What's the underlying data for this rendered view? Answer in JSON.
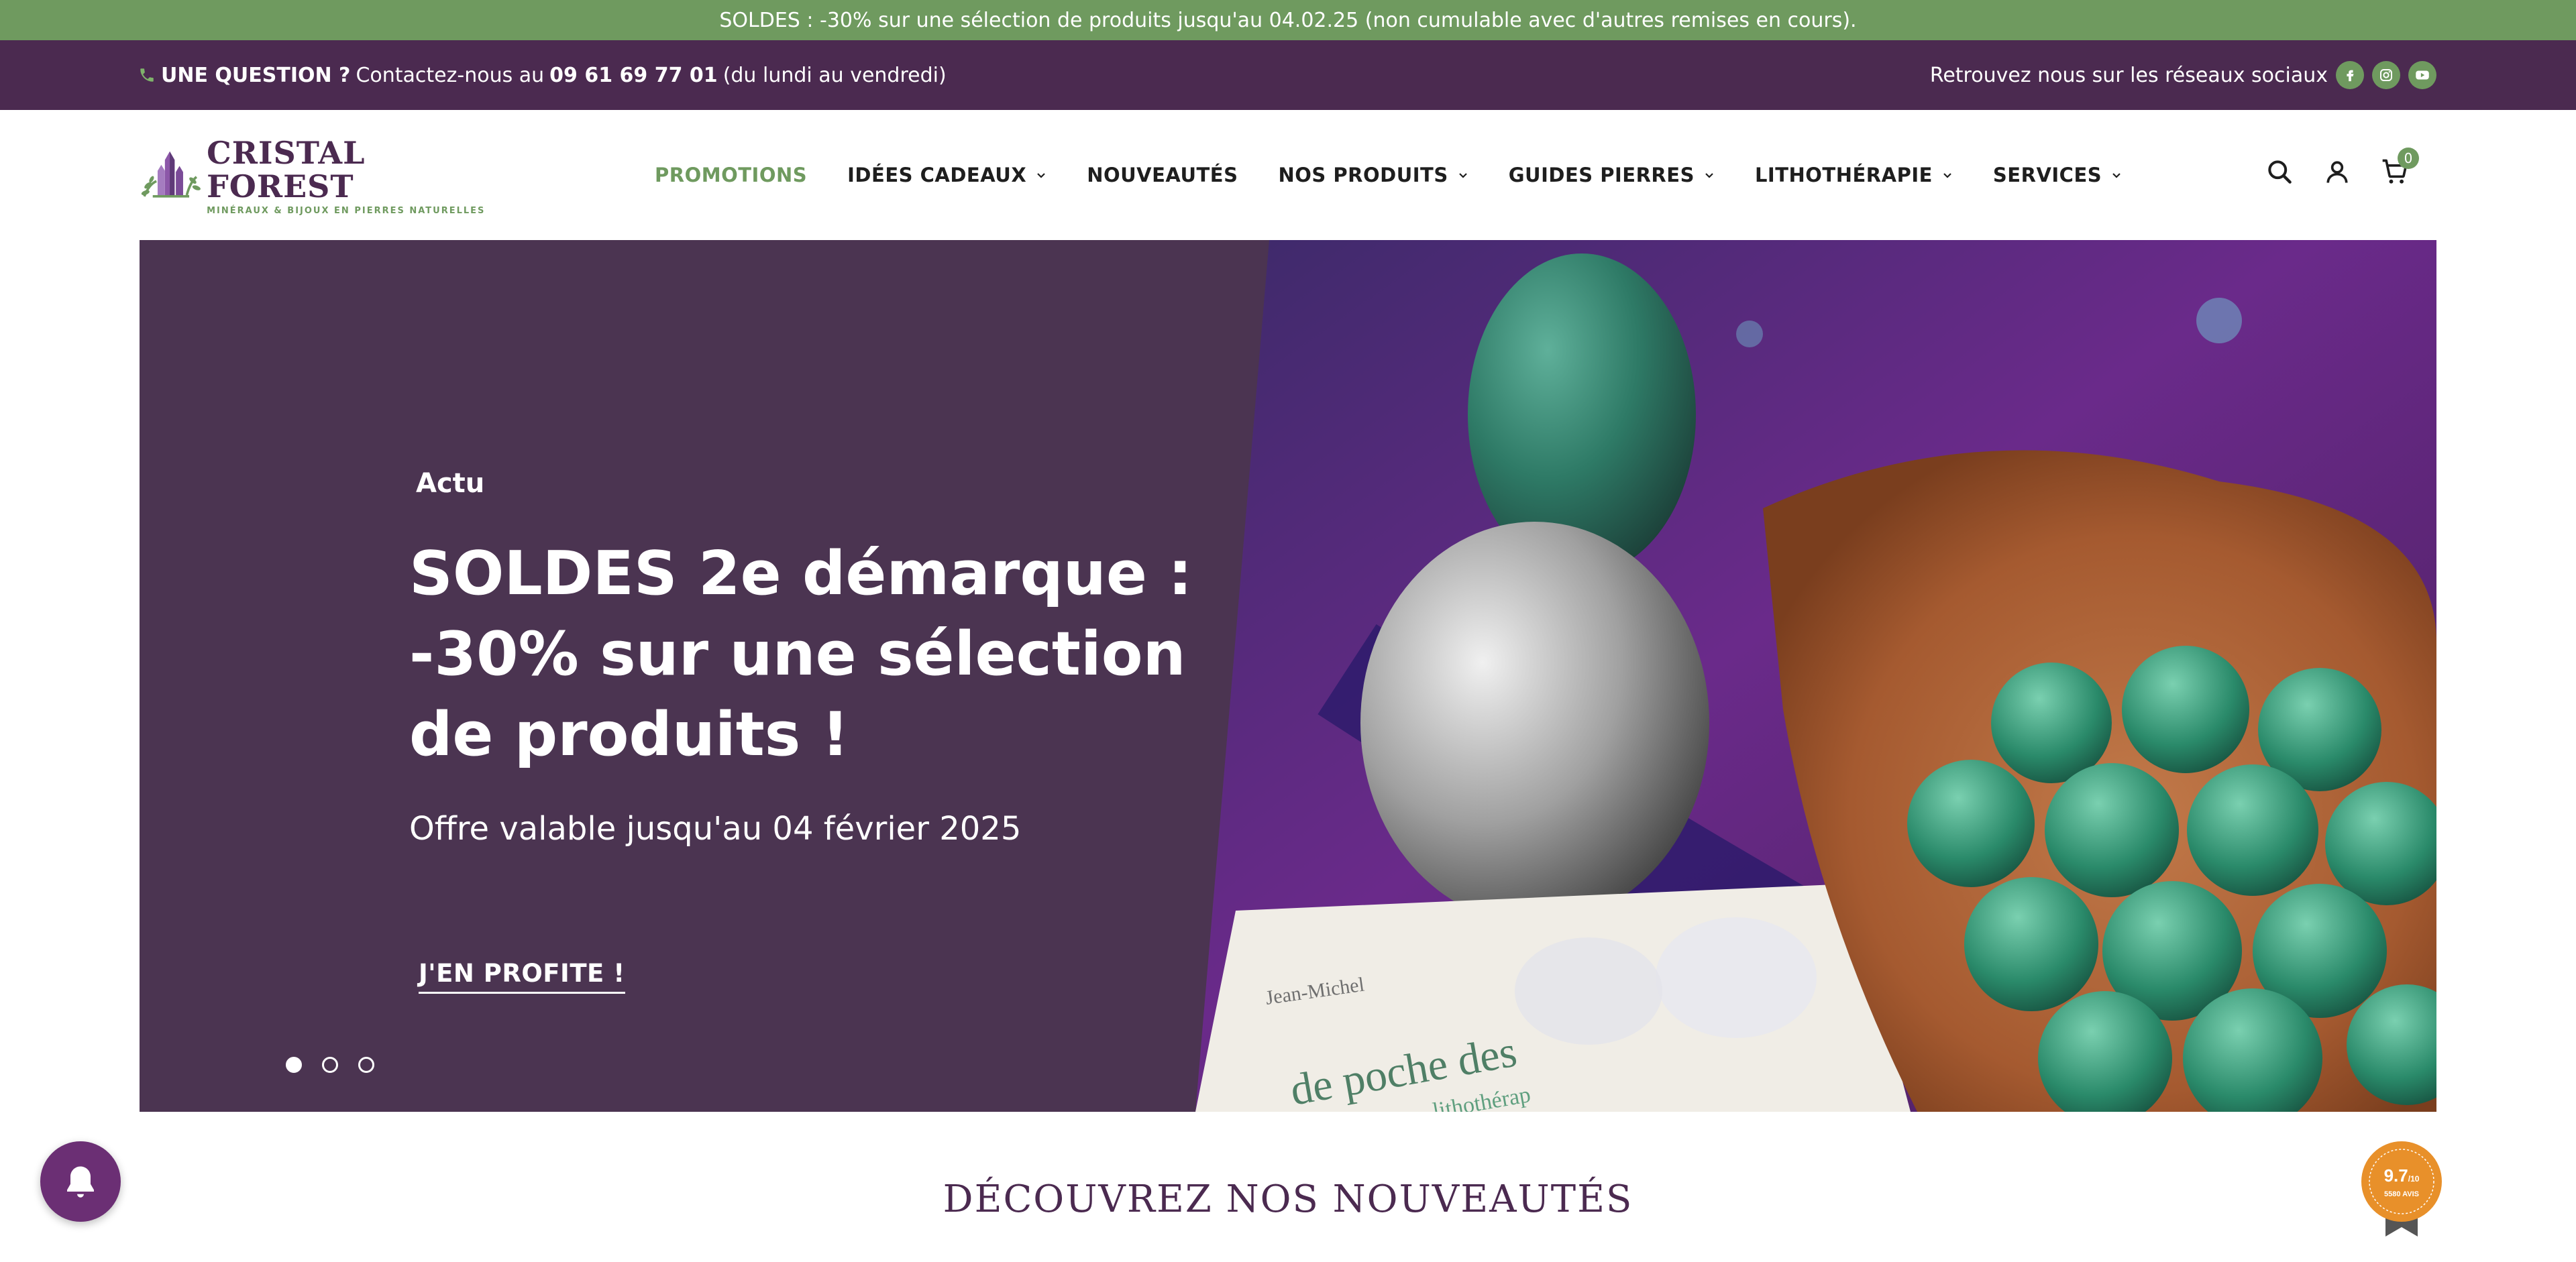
{
  "promo_bar": {
    "text": "SOLDES : -30% sur une sélection de produits jusqu'au 04.02.25 (non cumulable avec d'autres remises en cours)."
  },
  "info_bar": {
    "question_label": "UNE QUESTION ?",
    "contact_text": "Contactez-nous au",
    "phone": "09 61 69 77 01",
    "hours": "(du lundi au vendredi)",
    "social_text": "Retrouvez nous sur les réseaux sociaux",
    "social_icons": [
      "facebook-icon",
      "instagram-icon",
      "youtube-icon"
    ]
  },
  "logo": {
    "title": "CRISTAL FOREST",
    "subtitle": "MINÉRAUX & BIJOUX EN PIERRES NATURELLES"
  },
  "nav": {
    "items": [
      {
        "label": "PROMOTIONS",
        "dropdown": false,
        "active": true
      },
      {
        "label": "IDÉES CADEAUX",
        "dropdown": true
      },
      {
        "label": "NOUVEAUTÉS",
        "dropdown": false
      },
      {
        "label": "NOS PRODUITS",
        "dropdown": true
      },
      {
        "label": "GUIDES PIERRES",
        "dropdown": true
      },
      {
        "label": "LITHOTHÉRAPIE",
        "dropdown": true
      },
      {
        "label": "SERVICES",
        "dropdown": true
      }
    ]
  },
  "header_icons": {
    "cart_count": "0",
    "icons": [
      "search-icon",
      "user-icon",
      "cart-icon"
    ]
  },
  "hero": {
    "kicker": "Actu",
    "title_line1": "SOLDES 2e démarque :",
    "title_line2": "-30% sur une sélection",
    "title_line3": "de produits !",
    "subtitle": "Offre valable jusqu'au 04 février 2025",
    "cta": "J'EN PROFITE !",
    "slide_count": 3,
    "active_slide": 1,
    "photo_text_1": "Jean-Michel",
    "photo_text_2": "de poche des",
    "photo_text_3": "lithothérap"
  },
  "section": {
    "title": "DÉCOUVREZ NOS NOUVEAUTÉS"
  },
  "review_badge": {
    "score": "9.7",
    "scale": "/10",
    "count": "5580 AVIS"
  },
  "colors": {
    "green": "#6f9a5f",
    "purple": "#4b2a50",
    "hero_purple": "#4b3451",
    "bell_purple": "#6b2f74",
    "badge_orange": "#e8902a"
  }
}
